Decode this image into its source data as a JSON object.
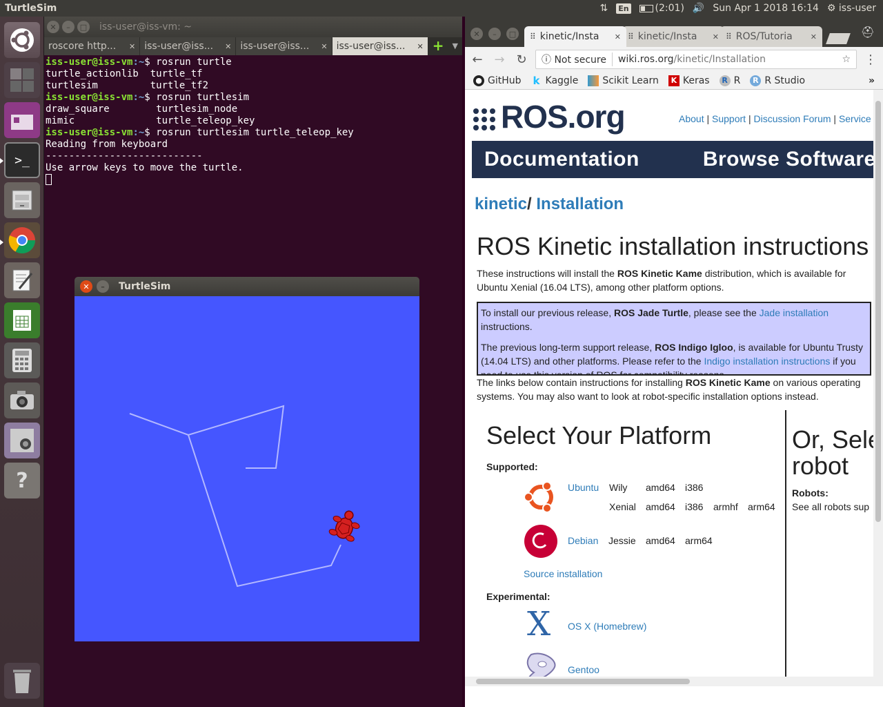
{
  "topbar": {
    "app_title": "TurtleSim",
    "keyboard_layout": "En",
    "battery": "(2:01)",
    "datetime": "Sun Apr  1 2018 16:14",
    "user": "iss-user"
  },
  "launcher": {
    "items": [
      "ubuntu-dash",
      "workspace-switcher",
      "window-app",
      "terminal",
      "files",
      "chrome",
      "text-editor",
      "spreadsheet",
      "calculator",
      "camera",
      "webcam",
      "help",
      "trash"
    ]
  },
  "terminal": {
    "title": "iss-user@iss-vm: ~",
    "tabs": [
      {
        "label": "roscore http..."
      },
      {
        "label": "iss-user@iss..."
      },
      {
        "label": "iss-user@iss..."
      },
      {
        "label": "iss-user@iss..."
      }
    ],
    "prompt_user": "iss-user@iss-vm",
    "prompt_path": ":~",
    "lines": {
      "cmd1": "$ rosrun turtle",
      "out1a": "turtle_actionlib  turtle_tf",
      "out1b": "turtlesim         turtle_tf2",
      "cmd2": "$ rosrun turtlesim",
      "out2a": "draw_square        turtlesim_node",
      "out2b": "mimic              turtle_teleop_key",
      "cmd3": "$ rosrun turtlesim turtle_teleop_key",
      "out3a": "Reading from keyboard",
      "out3b": "---------------------------",
      "out3c": "Use arrow keys to move the turtle."
    }
  },
  "turtlesim": {
    "title": "TurtleSim",
    "background": "#4556ff",
    "path_color": "#b3b8ff",
    "turtle_color": "#d42020"
  },
  "chrome": {
    "tabs": [
      {
        "label": "kinetic/Insta",
        "active": true
      },
      {
        "label": "kinetic/Insta",
        "active": false
      },
      {
        "label": "ROS/Tutoria",
        "active": false
      }
    ],
    "omnibox": {
      "security": "Not secure",
      "host": "wiki.ros.org",
      "path": "/kinetic/Installation"
    },
    "bookmarks": [
      {
        "label": "GitHub",
        "icon": "github-icon"
      },
      {
        "label": "Kaggle",
        "icon": "kaggle-icon"
      },
      {
        "label": "Scikit Learn",
        "icon": "scikit-icon"
      },
      {
        "label": "Keras",
        "icon": "keras-icon"
      },
      {
        "label": "R",
        "icon": "r-icon"
      },
      {
        "label": "R Studio",
        "icon": "rstudio-icon"
      }
    ]
  },
  "page": {
    "logo": "ROS.org",
    "links": [
      "About",
      "Support",
      "Discussion Forum",
      "Service"
    ],
    "nav": [
      "Documentation",
      "Browse Software"
    ],
    "crumb_1": "kinetic",
    "crumb_2": "Installation",
    "h1": "ROS Kinetic installation instructions",
    "p1_pre": "These instructions will install the ",
    "p1_bold": "ROS Kinetic Kame",
    "p1_post": " distribution, which is available for Ubuntu Xenial (16.04 LTS), among other platform options.",
    "notice1_pre": "To install our previous release, ",
    "notice1_bold": "ROS Jade Turtle",
    "notice1_mid": ", please see the ",
    "notice1_link": "Jade installation",
    "notice1_post": " instructions.",
    "notice2_pre": "The previous long-term support release, ",
    "notice2_bold": "ROS Indigo Igloo",
    "notice2_mid": ", is available for Ubuntu Trusty (14.04 LTS) and other platforms. Please refer to the ",
    "notice2_link": "Indigo installation instructions",
    "notice2_post": " if you need to use this version of ROS for compatibility reasons.",
    "p2_pre": "The links below contain instructions for installing ",
    "p2_bold": "ROS Kinetic Kame",
    "p2_post": " on various operating systems. You may also want to look at robot-specific installation options instead.",
    "platform_h2": "Select Your Platform",
    "supported": "Supported:",
    "ubuntu": "Ubuntu",
    "wily": "Wily",
    "xenial": "Xenial",
    "amd64": "amd64",
    "i386": "i386",
    "armhf": "armhf",
    "arm64": "arm64",
    "debian": "Debian",
    "jessie": "Jessie",
    "source": "Source installation",
    "experimental": "Experimental:",
    "osx": "OS X (Homebrew)",
    "gentoo": "Gentoo",
    "robot_h2_a": "Or, Sele",
    "robot_h2_b": "robot",
    "robots": "Robots:",
    "robots_text": "See all robots sup"
  }
}
